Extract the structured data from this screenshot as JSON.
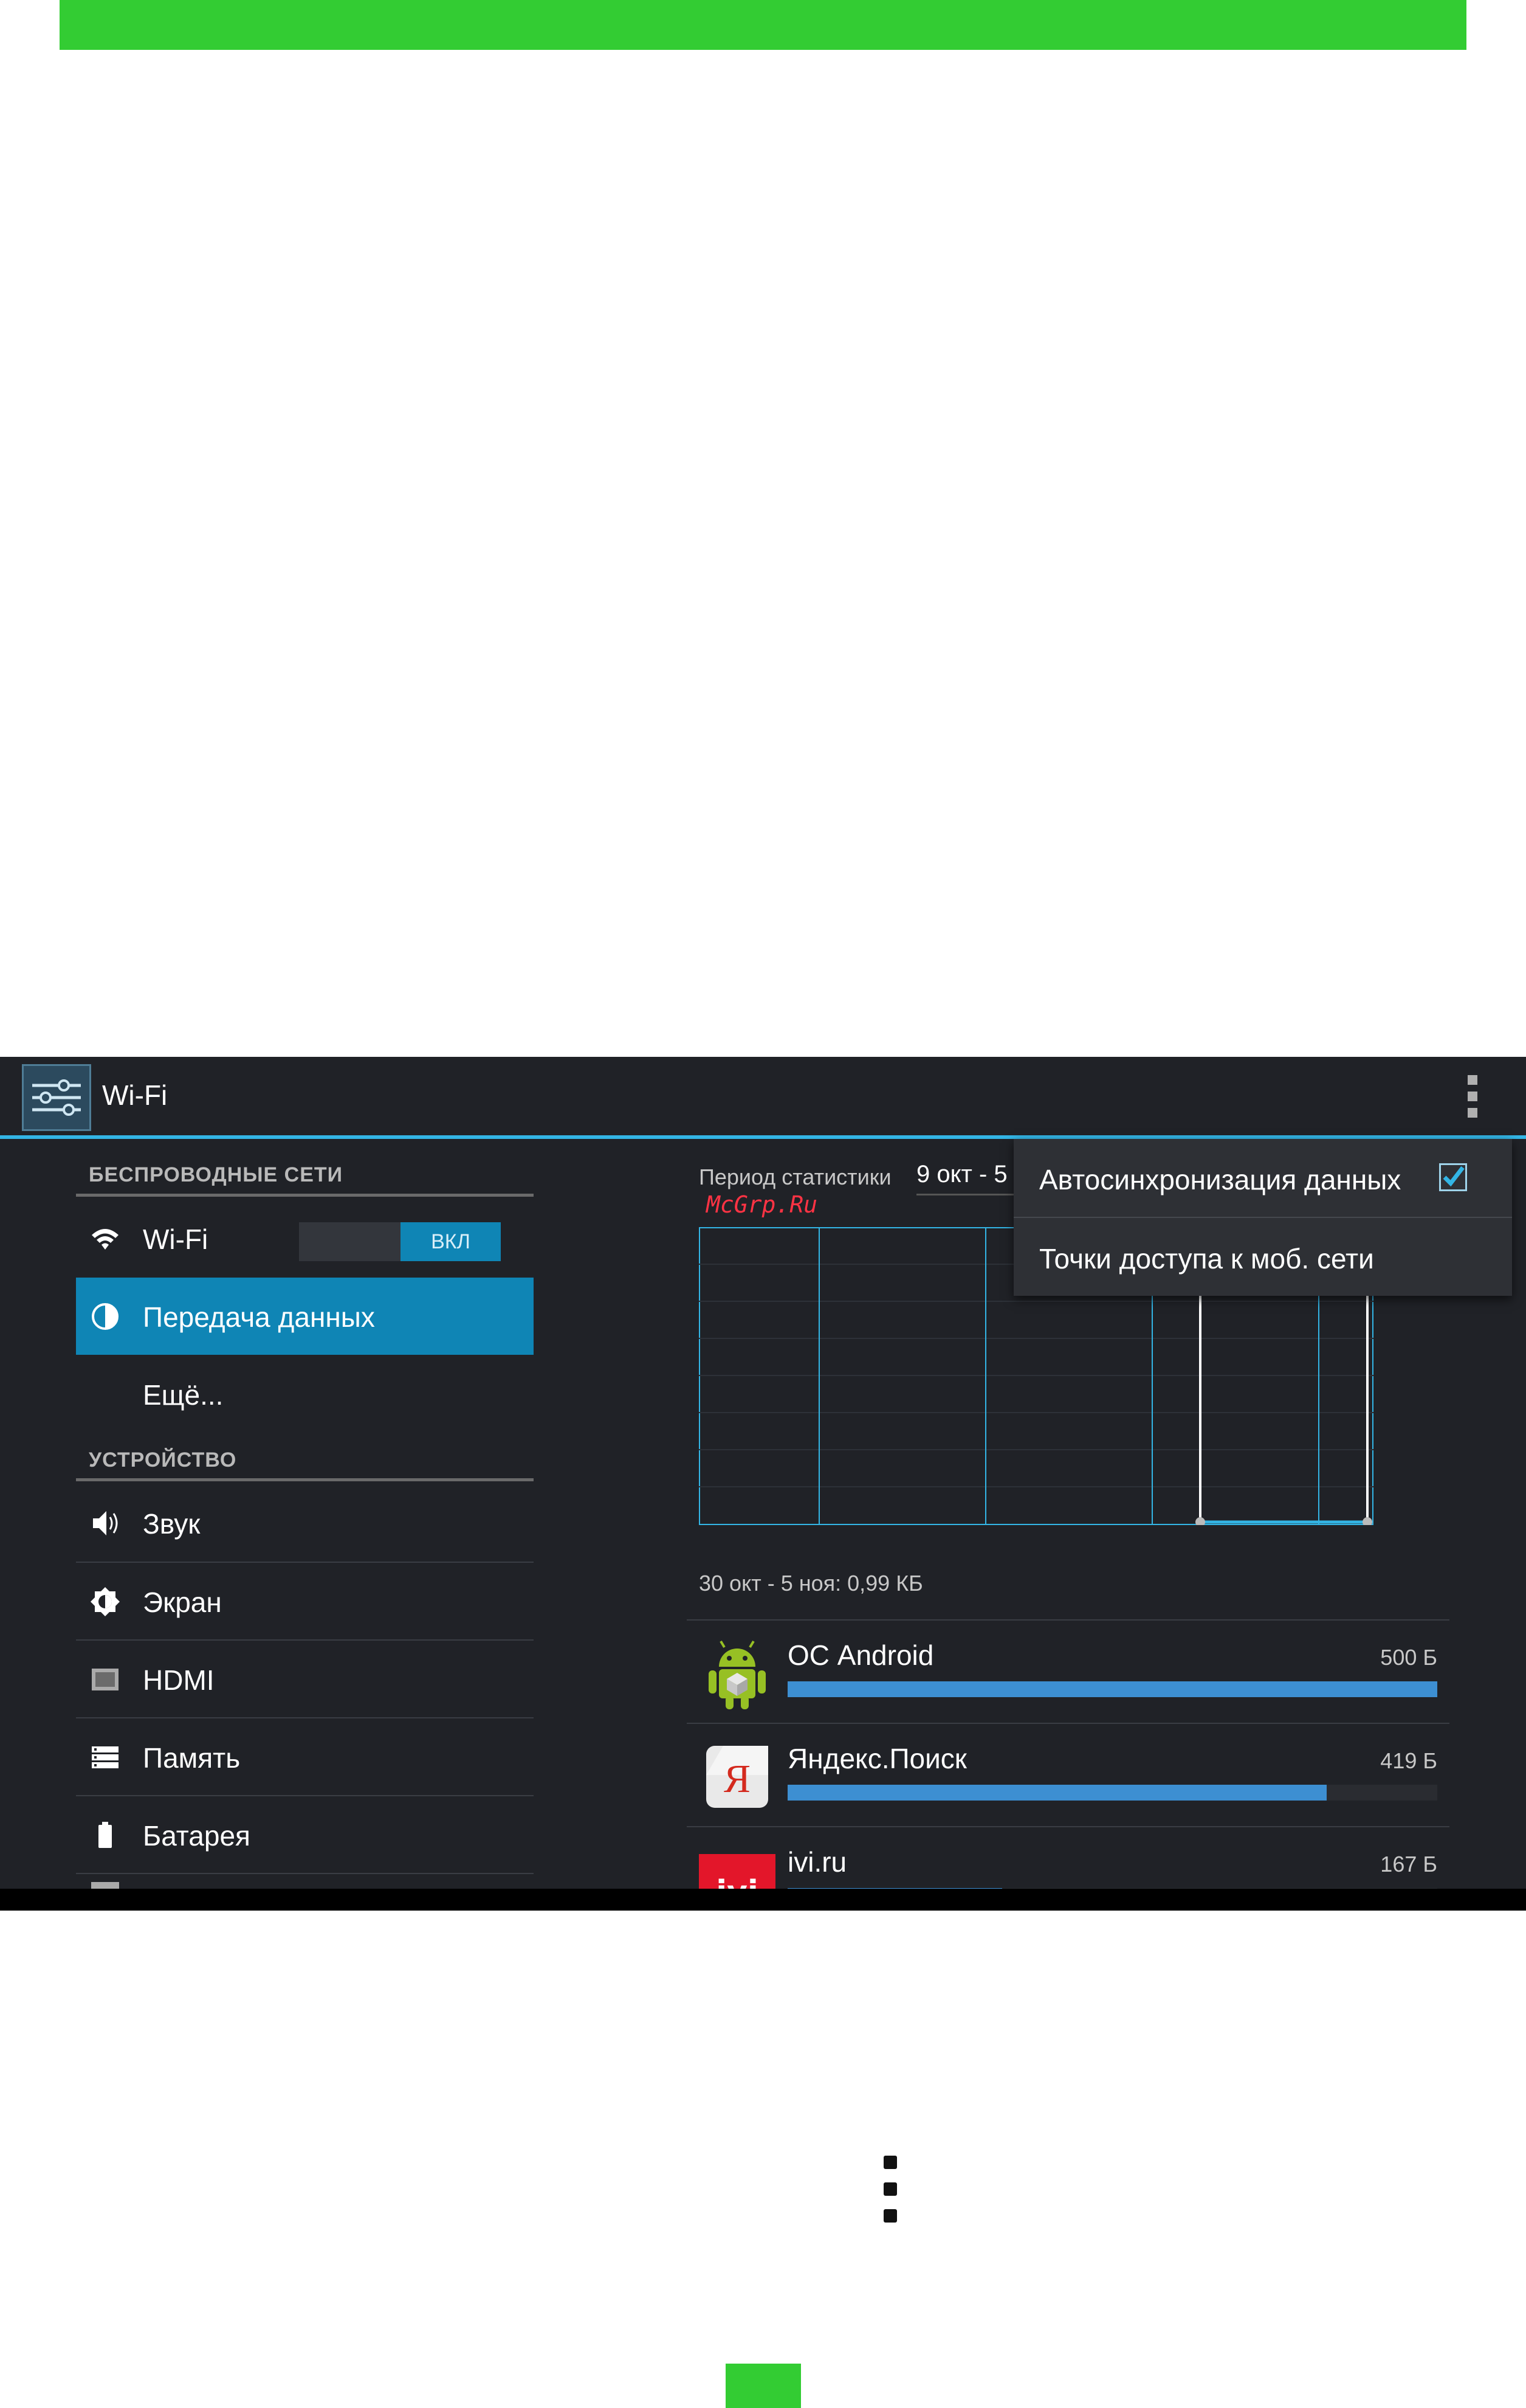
{
  "screen": {
    "actionbar": {
      "title": "Wi-Fi"
    },
    "nav": {
      "sections": [
        {
          "header": "БЕСПРОВОДНЫЕ СЕТИ"
        },
        {
          "header": "УСТРОЙСТВО"
        }
      ],
      "wifi": {
        "label": "Wi-Fi",
        "toggle_state": "ВКЛ"
      },
      "data_usage": {
        "label": "Передача данных"
      },
      "more": {
        "label": "Ещё..."
      },
      "sound": {
        "label": "Звук"
      },
      "display": {
        "label": "Экран"
      },
      "hdmi": {
        "label": "HDMI"
      },
      "storage": {
        "label": "Память"
      },
      "battery": {
        "label": "Батарея"
      }
    },
    "content": {
      "period_label": "Период статистики",
      "period_value": "9 окт - 5",
      "watermark": "McGrp.Ru",
      "range_label": "30 окт - 5 ноя: 0,99 КБ",
      "apps": [
        {
          "name": "ОС Android",
          "size": "500 Б",
          "fraction": 1.0,
          "icon": "android-icon"
        },
        {
          "name": "Яндекс.Поиск",
          "size": "419 Б",
          "fraction": 0.83,
          "icon": "yandex-icon"
        },
        {
          "name": "ivi.ru",
          "size": "167 Б",
          "fraction": 0.33,
          "icon": "ivi-icon"
        }
      ]
    },
    "popup": {
      "items": [
        {
          "label": "Автосинхронизация данных",
          "checked": true
        },
        {
          "label": "Точки доступа к моб. сети"
        }
      ]
    }
  },
  "colors": {
    "green_bar": "#33cc33",
    "accent": "#33b5e5",
    "selected": "#0f85b5",
    "usage_bar": "#3d8fd2"
  }
}
